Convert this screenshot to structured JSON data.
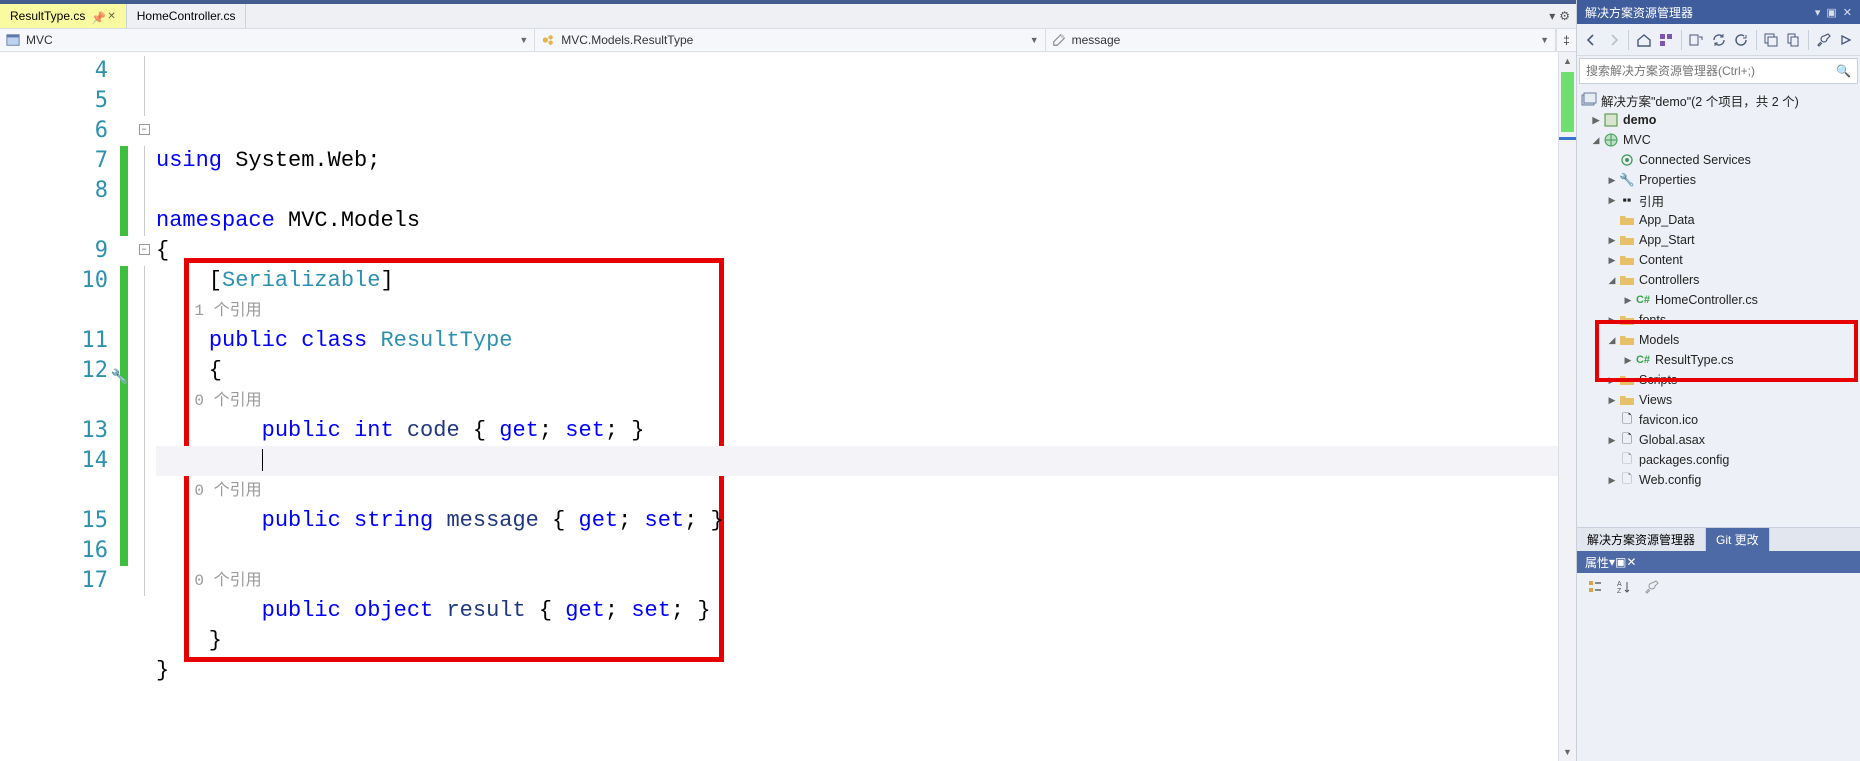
{
  "tabs": {
    "active": "ResultType.cs",
    "other": "HomeController.cs"
  },
  "navbar": {
    "project": "MVC",
    "class": "MVC.Models.ResultType",
    "member": "message"
  },
  "code": {
    "lines": [
      {
        "n": 4,
        "html": "<span class='kw'>using</span> System.Web;"
      },
      {
        "n": 5,
        "html": ""
      },
      {
        "n": 6,
        "html": "<span class='kw'>namespace</span> MVC.Models",
        "fold": true
      },
      {
        "n": 7,
        "html": "{",
        "green": true
      },
      {
        "n": 8,
        "html": "    [<span class='attr'>Serializable</span>]",
        "green": true,
        "lensAfter": "1 个引用"
      },
      {
        "n": 9,
        "html": "    <span class='kw'>public</span> <span class='kw'>class</span> <span class='type'>ResultType</span>",
        "fold": true
      },
      {
        "n": 10,
        "html": "    {",
        "green": true,
        "lensAfter": "0 个引用"
      },
      {
        "n": 11,
        "html": "        <span class='kw'>public</span> <span class='kw'>int</span> <span class='id'>code</span> { <span class='kw'>get</span>; <span class='kw'>set</span>; }",
        "green": true
      },
      {
        "n": 12,
        "html": "        <span class='cursor'></span>",
        "green": true,
        "current": true,
        "wrench": true,
        "lensAfter": "0 个引用"
      },
      {
        "n": 13,
        "html": "        <span class='kw'>public</span> <span class='kw'>string</span> <span class='id'>message</span> { <span class='kw'>get</span>; <span class='kw'>set</span>; }",
        "green": true
      },
      {
        "n": 14,
        "html": "",
        "green": true,
        "lensAfter": "0 个引用"
      },
      {
        "n": 15,
        "html": "        <span class='kw'>public</span> <span class='kw'>object</span> <span class='id'>result</span> { <span class='kw'>get</span>; <span class='kw'>set</span>; }",
        "green": true
      },
      {
        "n": 16,
        "html": "    }",
        "green": true
      },
      {
        "n": 17,
        "html": "}"
      }
    ]
  },
  "solution_explorer": {
    "title": "解决方案资源管理器",
    "search_placeholder": "搜索解决方案资源管理器(Ctrl+;)",
    "root": "解决方案\"demo\"(2 个项目，共 2 个)",
    "nodes": {
      "demo": "demo",
      "mvc": "MVC",
      "connected": "Connected Services",
      "properties": "Properties",
      "refs": "引用",
      "appdata": "App_Data",
      "appstart": "App_Start",
      "content": "Content",
      "controllers": "Controllers",
      "homectrl": "HomeController.cs",
      "fonts": "fonts",
      "models": "Models",
      "resulttype": "ResultType.cs",
      "scripts": "Scripts",
      "views": "Views",
      "favicon": "favicon.ico",
      "global": "Global.asax",
      "packages": "packages.config",
      "webconfig": "Web.config"
    },
    "bottom_tabs": {
      "sx": "解决方案资源管理器",
      "git": "Git 更改"
    }
  },
  "properties": {
    "title": "属性"
  }
}
